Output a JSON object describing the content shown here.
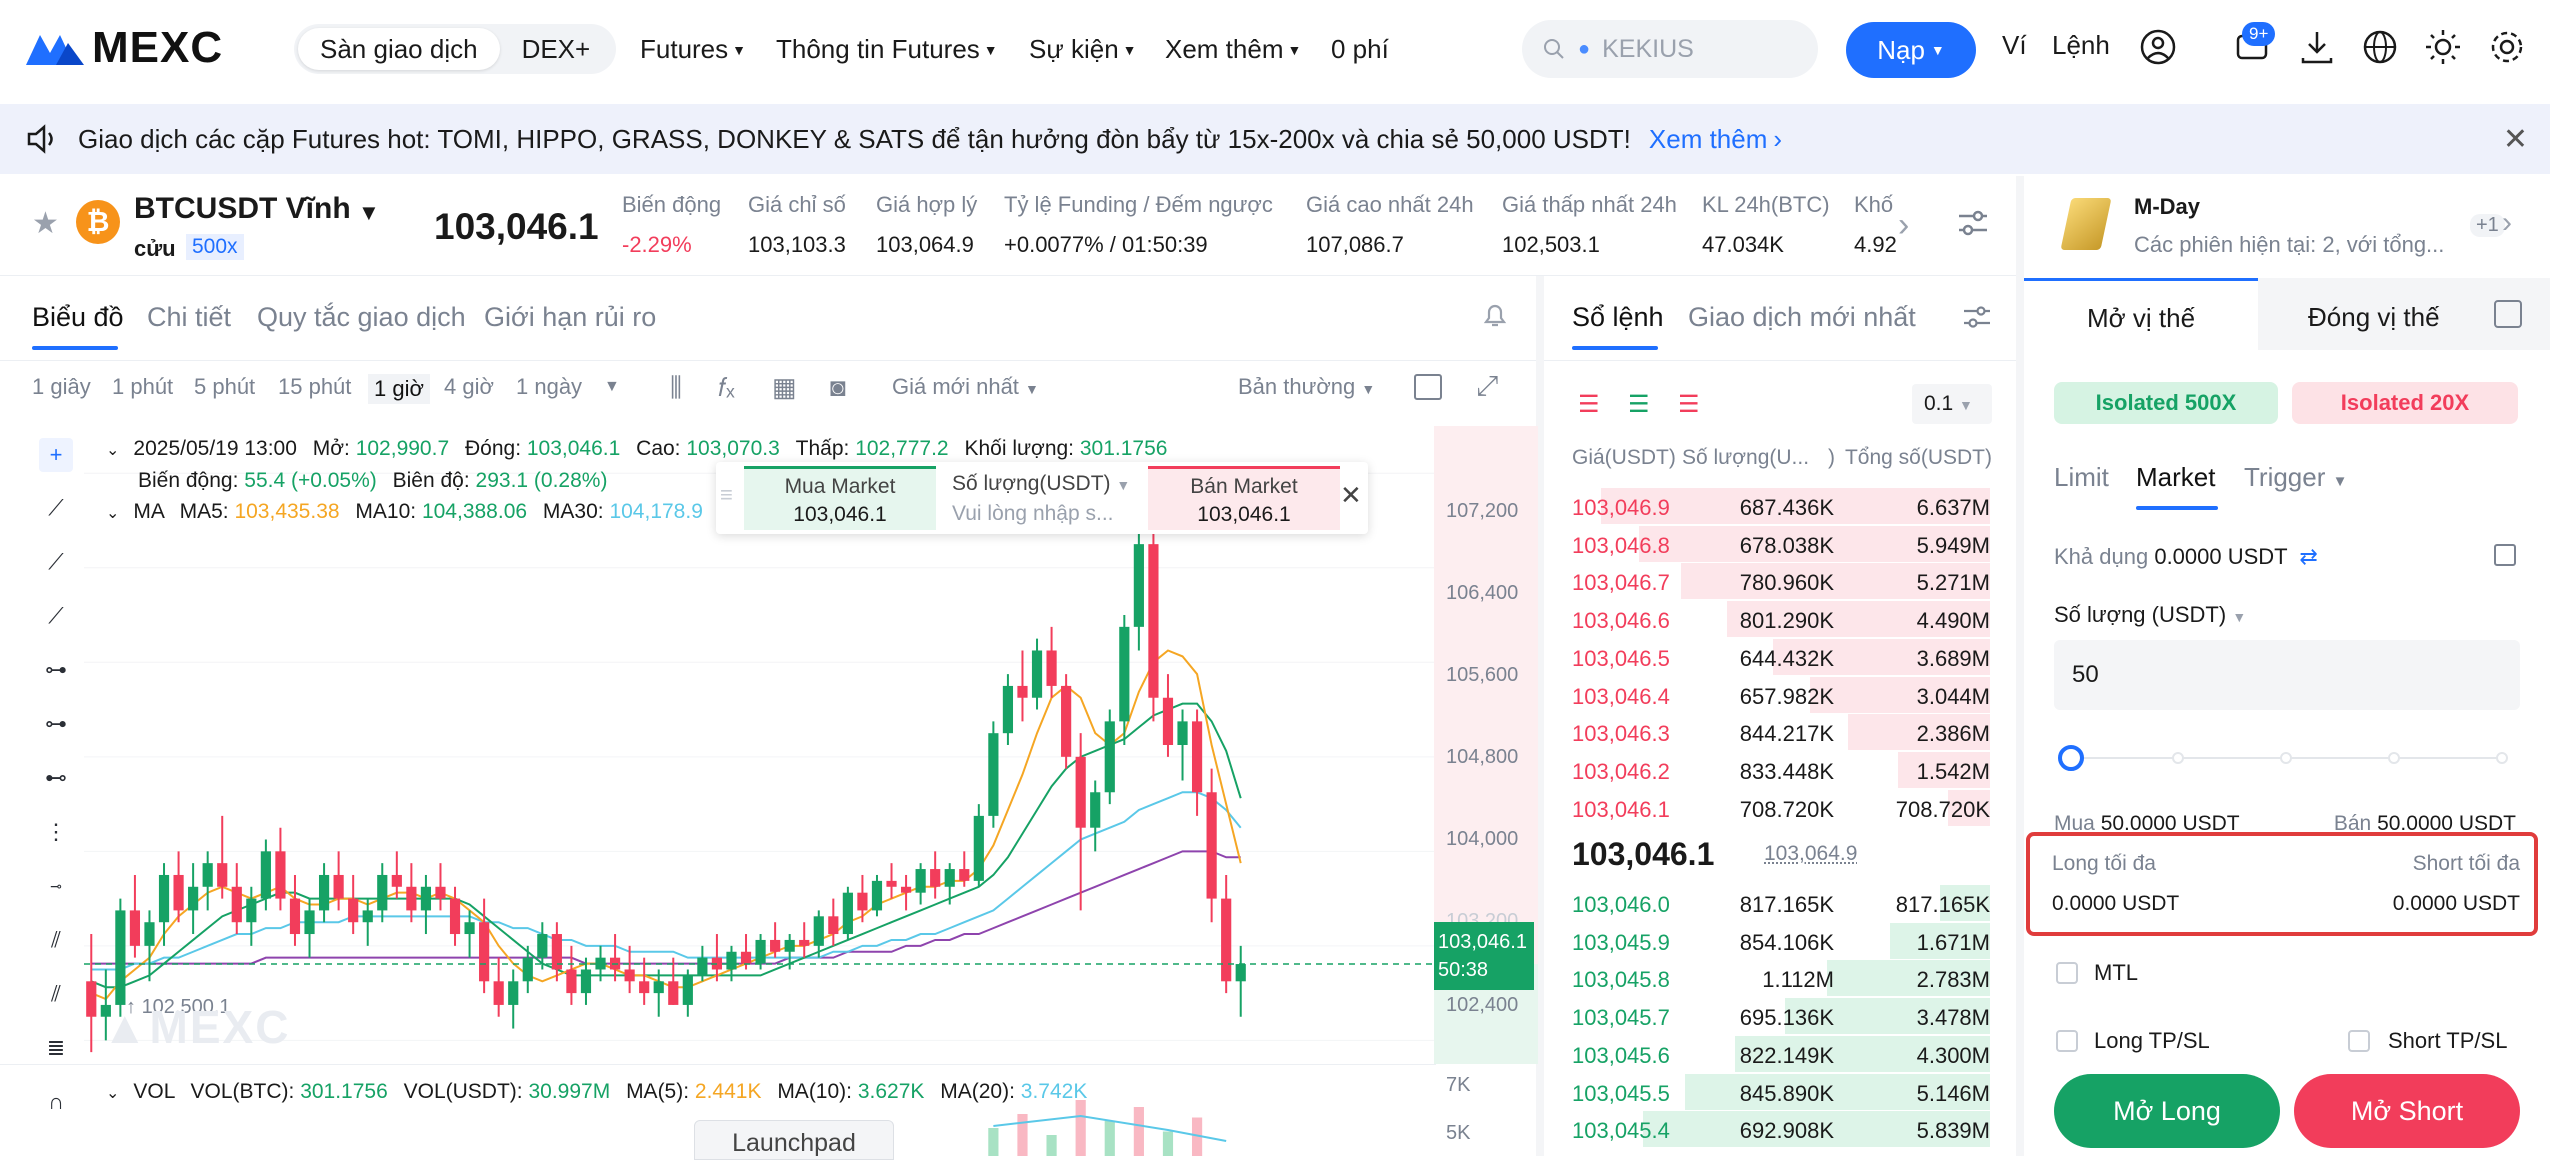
{
  "header": {
    "logo": "MEXC",
    "seg": [
      "Sàn giao dịch",
      "DEX+"
    ],
    "nav": [
      "Futures",
      "Thông tin Futures",
      "Sự kiện",
      "Xem thêm",
      "0 phí"
    ],
    "search_placeholder": "KEKIUS",
    "deposit": "Nạp",
    "wallet": "Ví",
    "orders": "Lệnh",
    "notif_badge": "9+"
  },
  "banner": {
    "text": "Giao dịch các cặp Futures hot: TOMI, HIPPO, GRASS, DONKEY & SATS để tận hưởng đòn bẩy từ 15x-200x và chia sẻ 50,000 USDT!",
    "link": "Xem thêm"
  },
  "ticker": {
    "symbol": "BTCUSDT Vĩnh",
    "symbol2": "cửu",
    "leverage": "500x",
    "last": "103,046.1",
    "cells": [
      {
        "label": "Biến động",
        "value": "-2.29%",
        "tone": "red"
      },
      {
        "label": "Giá chỉ số",
        "value": "103,103.3",
        "tone": ""
      },
      {
        "label": "Giá hợp lý",
        "value": "103,064.9",
        "tone": ""
      },
      {
        "label": "Tỷ lệ Funding / Đếm ngược",
        "value": "+0.0077% / 01:50:39",
        "tone": ""
      },
      {
        "label": "Giá cao nhất 24h",
        "value": "107,086.7",
        "tone": ""
      },
      {
        "label": "Giá thấp nhất 24h",
        "value": "102,503.1",
        "tone": ""
      },
      {
        "label": "KL 24h(BTC)",
        "value": "47.034K",
        "tone": ""
      },
      {
        "label": "Khố",
        "value": "4.92",
        "tone": ""
      }
    ]
  },
  "chart_tabs": [
    "Biểu đồ",
    "Chi tiết",
    "Quy tắc giao dịch",
    "Giới hạn rủi ro"
  ],
  "toolbar": {
    "intervals": [
      "1 giây",
      "1 phút",
      "5 phút",
      "15 phút",
      "1 giờ",
      "4 giờ",
      "1 ngày"
    ],
    "price_type": "Giá mới nhất",
    "view": "Bản thường"
  },
  "ohlc": {
    "date": "2025/05/19 13:00",
    "open_l": "Mở:",
    "open": "102,990.7",
    "close_l": "Đóng:",
    "close": "103,046.1",
    "high_l": "Cao:",
    "high": "103,070.3",
    "low_l": "Thấp:",
    "low": "102,777.2",
    "vol_l": "Khối lượng:",
    "vol": "301.1756",
    "chg_l": "Biến động:",
    "chg": "55.4 (+0.05%)",
    "amp_l": "Biên độ:",
    "amp": "293.1 (0.28%)"
  },
  "ma": {
    "label": "MA",
    "ma5_l": "MA5:",
    "ma5": "103,435.38",
    "ma10_l": "MA10:",
    "ma10": "104,388.06",
    "ma30_l": "MA30:",
    "ma30": "104,178.9"
  },
  "quick": {
    "buy": "Mua Market",
    "buy_price": "103,046.1",
    "qty": "Số lượng(USDT)",
    "qty_ph": "Vui lòng nhập s...",
    "sell": "Bán Market",
    "sell_price": "103,046.1"
  },
  "price_axis": [
    "107,200",
    "106,400",
    "105,600",
    "104,800",
    "104,000",
    "102,400"
  ],
  "price_axis_hidden": "103,200",
  "current_price_tag": "103,046.1",
  "countdown": "50:38",
  "low_label": "102,500.1",
  "vol": {
    "label": "VOL",
    "btc_l": "VOL(BTC):",
    "btc": "301.1756",
    "usdt_l": "VOL(USDT):",
    "usdt": "30.997M",
    "ma5_l": "MA(5):",
    "ma5": "2.441K",
    "ma10_l": "MA(10):",
    "ma10": "3.627K",
    "ma20_l": "MA(20):",
    "ma20": "3.742K",
    "axis": [
      "7K",
      "5K"
    ]
  },
  "launchpad": "Launchpad",
  "chart_data": {
    "type": "candlestick",
    "title": "BTCUSDT 1h",
    "ylim": [
      102200,
      107600
    ],
    "candles": [
      [
        102900,
        103300,
        102300,
        102600
      ],
      [
        102600,
        103000,
        102400,
        102700
      ],
      [
        102700,
        103600,
        102600,
        103500
      ],
      [
        103500,
        103800,
        103100,
        103200
      ],
      [
        103200,
        103500,
        102900,
        103400
      ],
      [
        103400,
        103900,
        103200,
        103800
      ],
      [
        103800,
        104000,
        103400,
        103500
      ],
      [
        103500,
        103900,
        103300,
        103700
      ],
      [
        103700,
        104000,
        103500,
        103900
      ],
      [
        103900,
        104300,
        103600,
        103700
      ],
      [
        103700,
        103900,
        103300,
        103400
      ],
      [
        103400,
        103700,
        103200,
        103600
      ],
      [
        103600,
        104100,
        103500,
        104000
      ],
      [
        104000,
        104200,
        103500,
        103600
      ],
      [
        103600,
        103800,
        103200,
        103300
      ],
      [
        103300,
        103600,
        103100,
        103500
      ],
      [
        103500,
        103900,
        103400,
        103800
      ],
      [
        103800,
        104000,
        103500,
        103600
      ],
      [
        103600,
        103800,
        103300,
        103400
      ],
      [
        103400,
        103600,
        103200,
        103500
      ],
      [
        103500,
        103900,
        103400,
        103800
      ],
      [
        103800,
        104000,
        103600,
        103700
      ],
      [
        103700,
        103900,
        103400,
        103500
      ],
      [
        103500,
        103800,
        103300,
        103700
      ],
      [
        103700,
        103900,
        103500,
        103600
      ],
      [
        103600,
        103700,
        103200,
        103300
      ],
      [
        103300,
        103500,
        103100,
        103400
      ],
      [
        103400,
        103600,
        102800,
        102900
      ],
      [
        102900,
        103100,
        102600,
        102700
      ],
      [
        102700,
        103000,
        102500,
        102900
      ],
      [
        102900,
        103200,
        102800,
        103100
      ],
      [
        103100,
        103400,
        103000,
        103300
      ],
      [
        103300,
        103400,
        102900,
        103000
      ],
      [
        103000,
        103200,
        102700,
        102800
      ],
      [
        102800,
        103100,
        102700,
        103000
      ],
      [
        103000,
        103200,
        102900,
        103100
      ],
      [
        103100,
        103300,
        102900,
        103000
      ],
      [
        103000,
        103200,
        102800,
        102900
      ],
      [
        102900,
        103100,
        102700,
        102800
      ],
      [
        102800,
        103000,
        102600,
        102900
      ],
      [
        102900,
        103100,
        102700,
        102700
      ],
      [
        102700,
        103000,
        102600,
        102950
      ],
      [
        102950,
        103200,
        102900,
        103100
      ],
      [
        103100,
        103300,
        102900,
        103000
      ],
      [
        103000,
        103200,
        102900,
        103150
      ],
      [
        103150,
        103300,
        103000,
        103050
      ],
      [
        103050,
        103300,
        103000,
        103250
      ],
      [
        103250,
        103400,
        103100,
        103150
      ],
      [
        103150,
        103300,
        103000,
        103250
      ],
      [
        103250,
        103400,
        103100,
        103200
      ],
      [
        103200,
        103500,
        103100,
        103450
      ],
      [
        103450,
        103600,
        103200,
        103300
      ],
      [
        103300,
        103700,
        103250,
        103650
      ],
      [
        103650,
        103800,
        103400,
        103500
      ],
      [
        103500,
        103800,
        103450,
        103750
      ],
      [
        103750,
        103900,
        103600,
        103700
      ],
      [
        103700,
        103800,
        103500,
        103650
      ],
      [
        103650,
        103900,
        103550,
        103850
      ],
      [
        103850,
        104000,
        103600,
        103700
      ],
      [
        103700,
        103900,
        103550,
        103850
      ],
      [
        103850,
        104000,
        103700,
        103750
      ],
      [
        103750,
        104400,
        103700,
        104300
      ],
      [
        104300,
        105100,
        104200,
        105000
      ],
      [
        105000,
        105500,
        104900,
        105400
      ],
      [
        105400,
        105700,
        105100,
        105300
      ],
      [
        105300,
        105800,
        105200,
        105700
      ],
      [
        105700,
        105900,
        105300,
        105400
      ],
      [
        105400,
        105500,
        104700,
        104800
      ],
      [
        104800,
        105000,
        103500,
        104200
      ],
      [
        104200,
        104600,
        104000,
        104500
      ],
      [
        104500,
        105200,
        104400,
        105100
      ],
      [
        105100,
        106000,
        104900,
        105900
      ],
      [
        105900,
        106800,
        105700,
        106600
      ],
      [
        106600,
        107100,
        105100,
        105300
      ],
      [
        105300,
        105500,
        104800,
        104900
      ],
      [
        104900,
        105200,
        104600,
        105100
      ],
      [
        105100,
        105200,
        104300,
        104500
      ],
      [
        104500,
        104700,
        103400,
        103600
      ],
      [
        103600,
        103800,
        102800,
        102900
      ],
      [
        102900,
        103200,
        102600,
        103046
      ]
    ],
    "ma5": [
      102800,
      102750,
      102900,
      103000,
      103100,
      103300,
      103450,
      103550,
      103650,
      103700,
      103650,
      103600,
      103650,
      103700,
      103600,
      103550,
      103550,
      103600,
      103600,
      103550,
      103600,
      103650,
      103650,
      103600,
      103650,
      103600,
      103500,
      103400,
      103200,
      103050,
      102950,
      102900,
      102950,
      103000,
      103050,
      103050,
      103000,
      102950,
      102950,
      102900,
      102850,
      102850,
      102900,
      102950,
      103000,
      103050,
      103100,
      103150,
      103200,
      103200,
      103250,
      103300,
      103400,
      103450,
      103550,
      103600,
      103650,
      103700,
      103700,
      103750,
      103750,
      103850,
      104050,
      104350,
      104650,
      105000,
      105300,
      105400,
      105300,
      105000,
      104900,
      105000,
      105350,
      105600,
      105700,
      105650,
      105500,
      104900,
      104400,
      103900
    ],
    "ma10": [
      102900,
      102850,
      102850,
      102900,
      102950,
      103050,
      103150,
      103250,
      103350,
      103450,
      103500,
      103550,
      103600,
      103650,
      103650,
      103600,
      103600,
      103600,
      103600,
      103600,
      103600,
      103600,
      103600,
      103600,
      103600,
      103600,
      103550,
      103450,
      103350,
      103250,
      103150,
      103050,
      103000,
      102950,
      102950,
      102950,
      102950,
      102950,
      102950,
      102950,
      102950,
      102950,
      102950,
      102950,
      102950,
      102950,
      102950,
      103000,
      103050,
      103100,
      103150,
      103200,
      103250,
      103300,
      103350,
      103400,
      103450,
      103500,
      103550,
      103600,
      103650,
      103700,
      103800,
      103950,
      104150,
      104350,
      104550,
      104700,
      104800,
      104850,
      104900,
      104950,
      105050,
      105150,
      105200,
      105250,
      105250,
      105100,
      104850,
      104450
    ],
    "ma30": [
      103000,
      103000,
      103000,
      103050,
      103050,
      103100,
      103100,
      103150,
      103200,
      103250,
      103300,
      103300,
      103350,
      103350,
      103400,
      103400,
      103400,
      103400,
      103450,
      103450,
      103450,
      103450,
      103450,
      103450,
      103450,
      103450,
      103450,
      103400,
      103400,
      103350,
      103350,
      103300,
      103250,
      103250,
      103200,
      103200,
      103200,
      103150,
      103150,
      103150,
      103150,
      103100,
      103100,
      103100,
      103100,
      103100,
      103100,
      103100,
      103100,
      103100,
      103100,
      103150,
      103150,
      103200,
      103200,
      103250,
      103250,
      103300,
      103300,
      103350,
      103400,
      103450,
      103500,
      103600,
      103700,
      103800,
      103900,
      104000,
      104100,
      104150,
      104200,
      104250,
      104350,
      104400,
      104450,
      104500,
      104500,
      104450,
      104350,
      104200
    ],
    "ma60": [
      103050,
      103050,
      103050,
      103050,
      103050,
      103050,
      103050,
      103050,
      103050,
      103050,
      103050,
      103050,
      103100,
      103100,
      103100,
      103100,
      103100,
      103100,
      103100,
      103100,
      103100,
      103100,
      103100,
      103100,
      103100,
      103100,
      103100,
      103100,
      103100,
      103100,
      103100,
      103100,
      103100,
      103100,
      103050,
      103050,
      103050,
      103050,
      103050,
      103050,
      103050,
      103050,
      103050,
      103050,
      103050,
      103050,
      103050,
      103050,
      103100,
      103100,
      103100,
      103100,
      103150,
      103150,
      103150,
      103150,
      103200,
      103200,
      103250,
      103250,
      103300,
      103300,
      103350,
      103400,
      103450,
      103500,
      103550,
      103600,
      103650,
      103700,
      103750,
      103800,
      103850,
      103900,
      103950,
      104000,
      104000,
      104000,
      103950,
      103950
    ],
    "current": 103046.1
  },
  "orderbook": {
    "tabs": [
      "Sổ lệnh",
      "Giao dịch mới nhất"
    ],
    "precision": "0.1",
    "headers": [
      "Giá(USDT)",
      "Số lượng(U...",
      ")",
      "Tổng số(USDT)"
    ],
    "asks": [
      {
        "p": "103,046.9",
        "q": "687.436K",
        "t": "6.637M",
        "depth": 0.93
      },
      {
        "p": "103,046.8",
        "q": "678.038K",
        "t": "5.949M",
        "depth": 0.84
      },
      {
        "p": "103,046.7",
        "q": "780.960K",
        "t": "5.271M",
        "depth": 0.74
      },
      {
        "p": "103,046.6",
        "q": "801.290K",
        "t": "4.490M",
        "depth": 0.63
      },
      {
        "p": "103,046.5",
        "q": "644.432K",
        "t": "3.689M",
        "depth": 0.52
      },
      {
        "p": "103,046.4",
        "q": "657.982K",
        "t": "3.044M",
        "depth": 0.43
      },
      {
        "p": "103,046.3",
        "q": "844.217K",
        "t": "2.386M",
        "depth": 0.34
      },
      {
        "p": "103,046.2",
        "q": "833.448K",
        "t": "1.542M",
        "depth": 0.22
      },
      {
        "p": "103,046.1",
        "q": "708.720K",
        "t": "708.720K",
        "depth": 0.1
      }
    ],
    "mid": "103,046.1",
    "mid_mark": "103,064.9",
    "bids": [
      {
        "p": "103,046.0",
        "q": "817.165K",
        "t": "817.165K",
        "depth": 0.12
      },
      {
        "p": "103,045.9",
        "q": "854.106K",
        "t": "1.671M",
        "depth": 0.24
      },
      {
        "p": "103,045.8",
        "q": "1.112M",
        "t": "2.783M",
        "depth": 0.39
      },
      {
        "p": "103,045.7",
        "q": "695.136K",
        "t": "3.478M",
        "depth": 0.49
      },
      {
        "p": "103,045.6",
        "q": "822.149K",
        "t": "4.300M",
        "depth": 0.61
      },
      {
        "p": "103,045.5",
        "q": "845.890K",
        "t": "5.146M",
        "depth": 0.73
      },
      {
        "p": "103,045.4",
        "q": "692.908K",
        "t": "5.839M",
        "depth": 0.83
      }
    ]
  },
  "promo": {
    "title": "M-Day",
    "sub": "Các phiên hiện tại: 2, với tổng...",
    "count": "+1"
  },
  "trade": {
    "tabs": [
      "Mở vị thế",
      "Đóng vị thế"
    ],
    "isolated_long": "Isolated 500X",
    "isolated_short": "Isolated 20X",
    "types": [
      "Limit",
      "Market",
      "Trigger"
    ],
    "available_l": "Khả dụng",
    "available": "0.0000 USDT",
    "qty_l": "Số lượng (USDT)",
    "qty": "50",
    "buy_l": "Mua",
    "buy": "50.0000 USDT",
    "sell_l": "Bán",
    "sell": "50.0000 USDT",
    "long_max_l": "Long tối đa",
    "long_max": "0.0000 USDT",
    "short_max_l": "Short tối đa",
    "short_max": "0.0000 USDT",
    "mtl": "MTL",
    "long_tpsl": "Long TP/SL",
    "short_tpsl": "Short TP/SL",
    "open_long": "Mở Long",
    "open_short": "Mở Short"
  },
  "colors": {
    "up": "#16a265",
    "down": "#f23d5b",
    "accent": "#1f6fff",
    "ma5": "#f5a623",
    "ma10": "#16a265",
    "ma30": "#5ac8e8",
    "ma60": "#8e44ad"
  }
}
